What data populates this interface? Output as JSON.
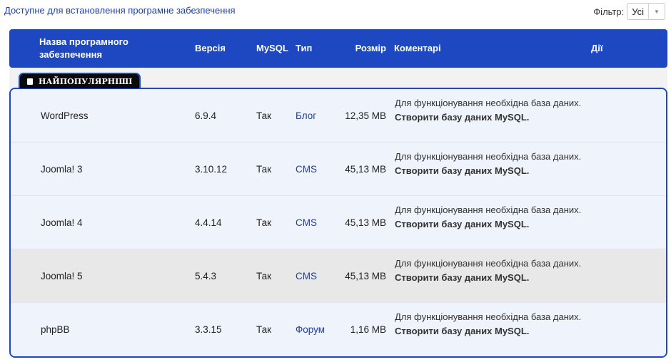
{
  "header": {
    "title": "Доступне для встановлення програмне забезпечення",
    "filter_label": "Фільтр:",
    "filter_value": "Усі"
  },
  "table": {
    "columns": {
      "name": "Назва програмного забезпечення",
      "version": "Версія",
      "mysql": "MySQL",
      "type": "Тип",
      "size": "Розмір",
      "comments": "Коментарі",
      "actions": "Дії"
    },
    "group_label": "НАЙПОПУЛЯРНІШІ",
    "rows": [
      {
        "name": "WordPress",
        "version": "6.9.4",
        "mysql": "Так",
        "type": "Блог",
        "size": "12,35 MB",
        "comment": "Для функціонування необхідна база даних.",
        "link": "Створити базу даних MySQL."
      },
      {
        "name": "Joomla! 3",
        "version": "3.10.12",
        "mysql": "Так",
        "type": "CMS",
        "size": "45,13 MB",
        "comment": "Для функціонування необхідна база даних.",
        "link": "Створити базу даних MySQL."
      },
      {
        "name": "Joomla! 4",
        "version": "4.4.14",
        "mysql": "Так",
        "type": "CMS",
        "size": "45,13 MB",
        "comment": "Для функціонування необхідна база даних.",
        "link": "Створити базу даних MySQL."
      },
      {
        "name": "Joomla! 5",
        "version": "5.4.3",
        "mysql": "Так",
        "type": "CMS",
        "size": "45,13 MB",
        "comment": "Для функціонування необхідна база даних.",
        "link": "Створити базу даних MySQL."
      },
      {
        "name": "phpBB",
        "version": "3.3.15",
        "mysql": "Так",
        "type": "Форум",
        "size": "1,16 MB",
        "comment": "Для функціонування необхідна база даних.",
        "link": "Створити базу даних MySQL."
      }
    ]
  },
  "colors": {
    "accent": "#1e48c2",
    "link": "#1f3f9f",
    "row_bg": "#eef3fc",
    "row_highlight": "#e8e8e8"
  }
}
